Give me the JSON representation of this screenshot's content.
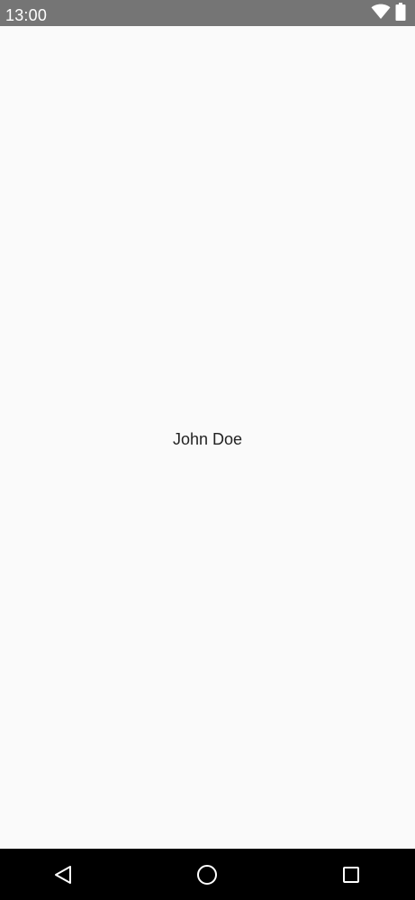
{
  "status_bar": {
    "time": "13:00",
    "icons": [
      "wifi-icon",
      "battery-icon"
    ]
  },
  "content": {
    "name": "John Doe"
  },
  "nav_bar": {
    "buttons": [
      "back",
      "home",
      "recents"
    ]
  },
  "colors": {
    "status_bar_bg": "#757575",
    "content_bg": "#fafafa",
    "nav_bar_bg": "#000000",
    "text": "#222222"
  }
}
